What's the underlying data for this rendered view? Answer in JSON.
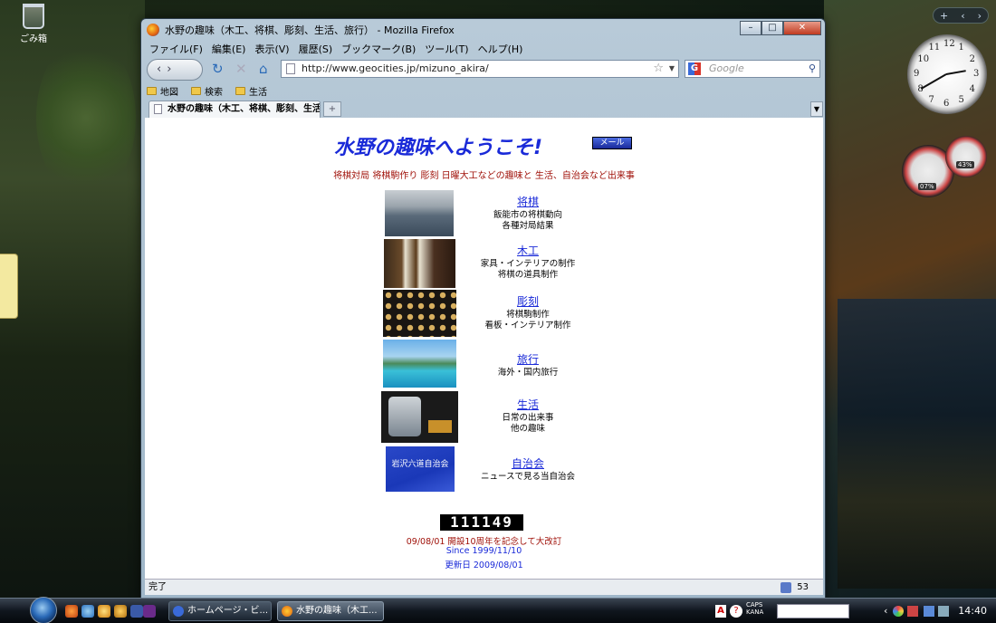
{
  "desktop": {
    "recycle_bin_label": "ごみ箱",
    "meter_cpu": "07%",
    "meter_mem": "43%",
    "clock_numbers": [
      "12",
      "1",
      "2",
      "3",
      "4",
      "5",
      "6",
      "7",
      "8",
      "9",
      "10",
      "11"
    ]
  },
  "window": {
    "title": "水野の趣味（木工、将棋、彫刻、生活、旅行） - Mozilla Firefox",
    "controls": {
      "minimize": "–",
      "maximize": "□",
      "close": "✕"
    }
  },
  "menu": [
    "ファイル(F)",
    "編集(E)",
    "表示(V)",
    "履歴(S)",
    "ブックマーク(B)",
    "ツール(T)",
    "ヘルプ(H)"
  ],
  "nav": {
    "url": "http://www.geocities.jp/mizuno_akira/",
    "search_placeholder": "Google",
    "back_icon": "‹",
    "forward_icon": "›",
    "reload_icon": "↻",
    "stop_icon": "✕",
    "home_icon": "⌂"
  },
  "bookmarks": [
    "地図",
    "検索",
    "生活"
  ],
  "tab": {
    "title": "水野の趣味（木工、将棋、彫刻、生活...",
    "new_tab": "+"
  },
  "page": {
    "heading": "水野の趣味へようこそ!",
    "mail_button": "メール",
    "intro": "将棋対局  将棋駒作り  彫刻  日曜大工などの趣味と  生活、自治会など出来事",
    "sections": [
      {
        "link": "将棋",
        "lines": [
          "飯能市の将棋動向",
          "各種対局結果"
        ]
      },
      {
        "link": "木工",
        "lines": [
          "家具・インテリアの制作",
          "将棋の道具制作"
        ]
      },
      {
        "link": "彫刻",
        "lines": [
          "将棋駒制作",
          "看板・インテリア制作"
        ]
      },
      {
        "link": "旅行",
        "lines": [
          "海外・国内旅行"
        ]
      },
      {
        "link": "生活",
        "lines": [
          "日常の出来事",
          "他の趣味"
        ]
      },
      {
        "link": "自治会",
        "lines": [
          "ニュースで見る当自治会"
        ]
      }
    ],
    "banner_text": "岩沢六道自治会",
    "counter": "111149",
    "footer": [
      {
        "text": "09/08/01 開設10周年を記念して大改訂",
        "color": "#a0120a"
      },
      {
        "text": "Since 1999/11/10",
        "color": "#1a2ad8"
      },
      {
        "text": "更新日 2009/08/01",
        "color": "#1a2ad8"
      }
    ]
  },
  "status": {
    "text": "完了",
    "count": "53"
  },
  "taskbar": {
    "tasks": [
      "ホームページ・ビ...",
      "水野の趣味（木工..."
    ],
    "caps_label": "CAPS",
    "kana_label": "KANA",
    "time": "14:40"
  }
}
